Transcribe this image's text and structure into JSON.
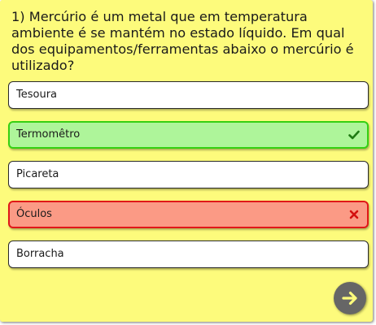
{
  "question": {
    "text": "1) Mercúrio é um metal que em temperatura ambiente é se mantém no estado líquido. Em qual dos equipamentos/ferramentas abaixo o mercúrio é utilizado?"
  },
  "options": [
    {
      "label": "Tesoura",
      "state": "neutral"
    },
    {
      "label": "Termomêtro",
      "state": "correct",
      "icon": "check-icon"
    },
    {
      "label": "Picareta",
      "state": "neutral"
    },
    {
      "label": "Óculos",
      "state": "wrong",
      "icon": "x-icon"
    },
    {
      "label": "Borracha",
      "state": "neutral"
    }
  ],
  "colors": {
    "card_background": "#fdfb7c",
    "correct_fill": "#aef59a",
    "correct_border": "#35d012",
    "check_icon": "#1f7a12",
    "wrong_fill": "#fb9a85",
    "wrong_border": "#e01818",
    "x_icon": "#d40f0f",
    "next_button": "#666666",
    "next_arrow": "#fdfb7c"
  },
  "next_button": {
    "icon": "arrow-right-icon"
  }
}
